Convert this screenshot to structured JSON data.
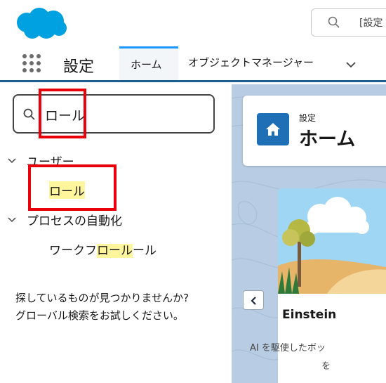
{
  "header": {
    "search_prefix": "[設定"
  },
  "nav": {
    "app_name": "設定",
    "tabs": [
      {
        "label": "ホーム"
      },
      {
        "label": "オブジェクトマネージャー"
      }
    ]
  },
  "sidebar": {
    "quick_find_value": "ロール",
    "tree": [
      {
        "group": "ユーザー",
        "items": [
          {
            "label_highlight": "ロール"
          }
        ]
      },
      {
        "group": "プロセスの自動化",
        "items": [
          {
            "before": "ワークフ",
            "highlight": "ロール",
            "after": "ール"
          }
        ]
      }
    ],
    "not_found_line1": "探しているものが見つかりませんか?",
    "not_found_line2": "グローバル検索をお試しください。"
  },
  "main": {
    "breadcrumb": "設定",
    "title": "ホーム",
    "card_title": "Einstein",
    "card_desc_line1": "AI を駆使したボッ",
    "card_desc_line2": "を"
  },
  "colors": {
    "accent": "#1b96ff",
    "nav_border": "#1b5f8f",
    "highlight": "#fff59d",
    "annotation": "#e8000a",
    "home_icon_bg": "#1e6fb5"
  }
}
